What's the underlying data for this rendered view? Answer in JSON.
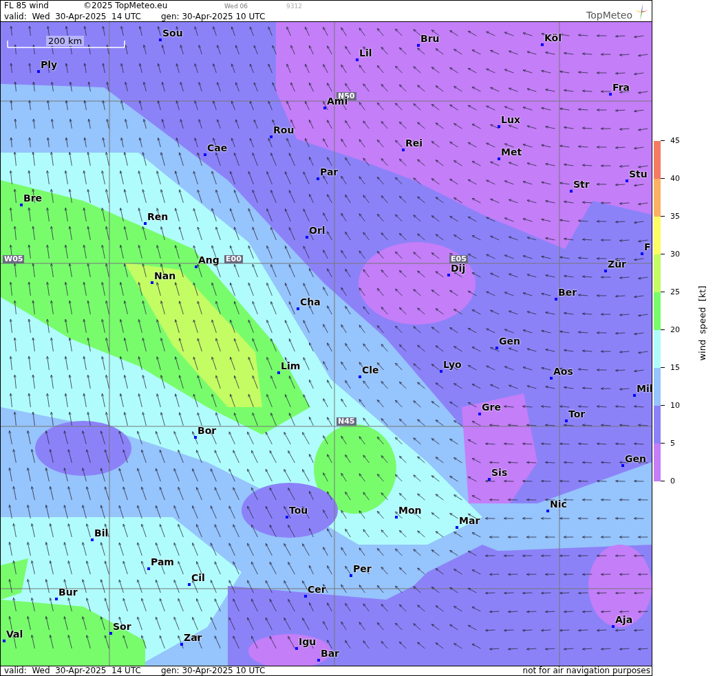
{
  "header": {
    "title": "FL 85 wind",
    "copyright": "©2025 TopMeteo.eu",
    "day": "Wed 06",
    "code": "9312",
    "valid": "valid:  Wed  30-Apr-2025  14 UTC",
    "gen": "gen: 30-Apr-2025 10 UTC",
    "logo": "TopMeteo"
  },
  "map": {
    "scale": "200 km",
    "grid_labels": [
      "N50",
      "W05",
      "E00",
      "E05",
      "N45"
    ],
    "cities": [
      {
        "name": "Sou"
      },
      {
        "name": "Ply"
      },
      {
        "name": "Lil"
      },
      {
        "name": "Bru"
      },
      {
        "name": "Köl"
      },
      {
        "name": "Ami"
      },
      {
        "name": "Fra"
      },
      {
        "name": "Rou"
      },
      {
        "name": "Lux"
      },
      {
        "name": "Cae"
      },
      {
        "name": "Rei"
      },
      {
        "name": "Met"
      },
      {
        "name": "Par"
      },
      {
        "name": "Stu"
      },
      {
        "name": "Str"
      },
      {
        "name": "Bre"
      },
      {
        "name": "Ren"
      },
      {
        "name": "Orl"
      },
      {
        "name": "Ang"
      },
      {
        "name": "Nan"
      },
      {
        "name": "Dij"
      },
      {
        "name": "Zür"
      },
      {
        "name": "F"
      },
      {
        "name": "Ber"
      },
      {
        "name": "Cha"
      },
      {
        "name": "Gen"
      },
      {
        "name": "Lim"
      },
      {
        "name": "Cle"
      },
      {
        "name": "Lyo"
      },
      {
        "name": "Aos"
      },
      {
        "name": "Mil"
      },
      {
        "name": "Tor"
      },
      {
        "name": "Gre"
      },
      {
        "name": "Bor"
      },
      {
        "name": "Gen"
      },
      {
        "name": "Sis"
      },
      {
        "name": "Nic"
      },
      {
        "name": "Tou"
      },
      {
        "name": "Mon"
      },
      {
        "name": "Mar"
      },
      {
        "name": "Bil"
      },
      {
        "name": "Pam"
      },
      {
        "name": "Per"
      },
      {
        "name": "Cil"
      },
      {
        "name": "Cer"
      },
      {
        "name": "Bur"
      },
      {
        "name": "Aja"
      },
      {
        "name": "Sor"
      },
      {
        "name": "Val"
      },
      {
        "name": "Zar"
      },
      {
        "name": "Igu"
      },
      {
        "name": "Bar"
      }
    ]
  },
  "legend": {
    "title": "wind speed [kt]",
    "ticks": [
      "45",
      "40",
      "35",
      "30",
      "25",
      "20",
      "15",
      "10",
      "5",
      "0"
    ],
    "bands": [
      {
        "color": "#f47c64"
      },
      {
        "color": "#fcb064"
      },
      {
        "color": "#fcfc64"
      },
      {
        "color": "#c4fc64"
      },
      {
        "color": "#78fc6c"
      },
      {
        "color": "#b0fcfc"
      },
      {
        "color": "#96c4fc"
      },
      {
        "color": "#8c82f8"
      },
      {
        "color": "#c47ef8"
      }
    ]
  },
  "footer": {
    "valid": "valid:  Wed  30-Apr-2025  14 UTC",
    "gen": "gen: 30-Apr-2025 10 UTC",
    "disclaimer": "not for air navigation purposes"
  }
}
